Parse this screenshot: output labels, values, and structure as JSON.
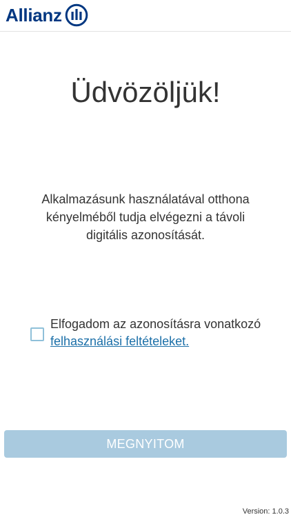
{
  "header": {
    "brand_name": "Allianz",
    "logo_icon": "allianz-eagle-logo",
    "brand_color": "#003781"
  },
  "main": {
    "title": "Üdvözöljük!",
    "intro_text": "Alkalmazásunk használatával otthona kényelméből tudja elvégezni a távoli digitális azonosítását."
  },
  "consent": {
    "checked": false,
    "text": "Elfogadom az azonosításra vonatkozó",
    "link_text": "felhasználási feltételeket.",
    "link_color": "#1b6fa8"
  },
  "actions": {
    "open_label": "MEGNYITOM",
    "open_enabled": false,
    "button_color": "#a9cadf"
  },
  "footer": {
    "version": "Version: 1.0.3"
  }
}
